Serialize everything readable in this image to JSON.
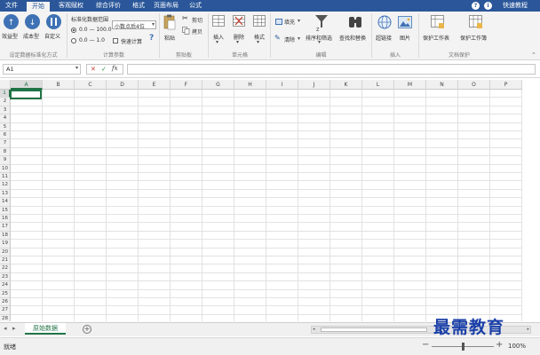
{
  "tabs": [
    "文件",
    "开始",
    "客观赋权",
    "综合评价",
    "格式",
    "页面布局",
    "公式"
  ],
  "active_tab_index": 1,
  "title_right": {
    "help": "?",
    "info": "i",
    "quick_tutorial": "快速教程"
  },
  "ribbon": {
    "standardize": {
      "efficiency": "效益型",
      "cost": "成本型",
      "custom": "自定义",
      "group_label": "设定数据标准化方式"
    },
    "calc": {
      "range_label": "标准化数据范围",
      "range_options": [
        "0.0 — 100.0",
        "0.0 — 1.0"
      ],
      "range_selected_index": 0,
      "decimal_select": "小数点后4位",
      "quick_calc": "快速计算",
      "help": "?",
      "group_label": "计算参数"
    },
    "clipboard": {
      "paste": "粘贴",
      "cut": "剪切",
      "copy": "拷贝",
      "group_label": "剪贴板"
    },
    "cells": {
      "insert": "插入",
      "delete": "删除",
      "format": "格式",
      "group_label": "单元格"
    },
    "editing": {
      "fill": "填充",
      "clear": "清除",
      "sort_filter": "排序和筛选",
      "find_replace": "查找和替换",
      "group_label": "编辑"
    },
    "insert": {
      "hyperlink": "超链接",
      "picture": "图片",
      "group_label": "插入"
    },
    "doc_protect": {
      "protect_sheet": "保护工作表",
      "protect_workbook": "保护工作簿",
      "group_label": "文档保护"
    }
  },
  "formula_bar": {
    "name_box": "A1",
    "cancel": "✕",
    "confirm": "✓",
    "fx": "fx",
    "formula": ""
  },
  "grid": {
    "columns": [
      "A",
      "B",
      "C",
      "D",
      "E",
      "F",
      "G",
      "H",
      "I",
      "J",
      "K",
      "L",
      "M",
      "N",
      "O",
      "P"
    ],
    "row_count": 28,
    "selected_cell": "A1"
  },
  "sheets": {
    "tabs": [
      "原始数据"
    ],
    "add": "+"
  },
  "status": {
    "ready": "就绪",
    "zoom": "100%",
    "zoom_level": 0.5,
    "minus": "−",
    "plus": "+"
  },
  "watermark": "最需教育"
}
